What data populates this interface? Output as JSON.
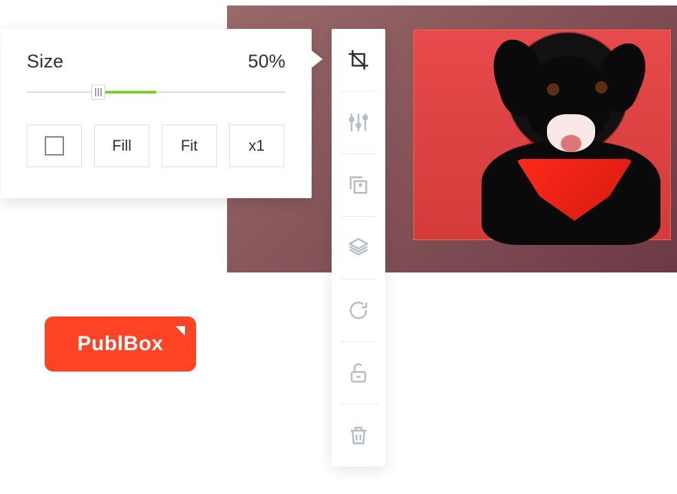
{
  "size_panel": {
    "label": "Size",
    "value": "50%",
    "slider_percent": 50,
    "buttons": {
      "square": "",
      "fill": "Fill",
      "fit": "Fit",
      "x1": "x1"
    }
  },
  "toolbar": {
    "tools": [
      {
        "name": "crop-icon",
        "active": true
      },
      {
        "name": "adjust-icon",
        "active": false
      },
      {
        "name": "duplicate-icon",
        "active": false
      },
      {
        "name": "layers-icon",
        "active": false
      },
      {
        "name": "rotate-icon",
        "active": false
      },
      {
        "name": "unlock-icon",
        "active": false
      },
      {
        "name": "trash-icon",
        "active": false
      }
    ]
  },
  "logo": {
    "text": "PublBox"
  },
  "canvas": {
    "subject": "black dog with red bandana on red background"
  }
}
